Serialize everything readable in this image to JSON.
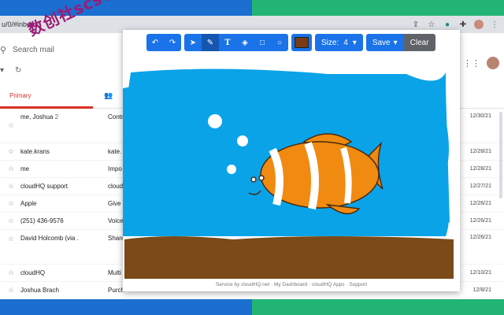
{
  "browser": {
    "url": "u/0/#inbox",
    "icons": [
      "share-icon",
      "star-icon",
      "extension-icon",
      "puzzle-icon",
      "avatar",
      "menu-icon"
    ]
  },
  "gmail": {
    "search_placeholder": "Search mail",
    "tabs": [
      {
        "label": "Primary"
      }
    ],
    "rows": [
      {
        "sender": "me, Joshua",
        "count": "2",
        "subject": "Contr",
        "date": "12/30/21"
      },
      {
        "sender": "kate.krans",
        "subject": "kate.",
        "date": "12/28/21"
      },
      {
        "sender": "me",
        "subject": "Impo",
        "date": "12/28/21"
      },
      {
        "sender": "cloudHQ support",
        "subject": "cloud",
        "date": "12/27/21"
      },
      {
        "sender": "Apple",
        "subject": "Give",
        "date": "12/26/21"
      },
      {
        "sender": "(251) 436-9576",
        "subject": "Voice",
        "date": "12/26/21"
      },
      {
        "sender": "David Holcomb (via .",
        "subject": "Share",
        "date": "12/26/21"
      },
      {
        "sender": "cloudHQ",
        "subject": "Multi",
        "date": "12/10/21"
      },
      {
        "sender": "Joshua Brach",
        "subject": "Purch",
        "date": "12/8/21"
      }
    ]
  },
  "watermark": "数创社scs66",
  "draw_tool": {
    "size_label": "Size:",
    "size_value": "4",
    "save_label": "Save",
    "clear_label": "Clear",
    "pen_color": "#7a3a17",
    "footer": "Service by cloudHQ.net · My Dashboard · cloudHQ Apps · Support"
  }
}
